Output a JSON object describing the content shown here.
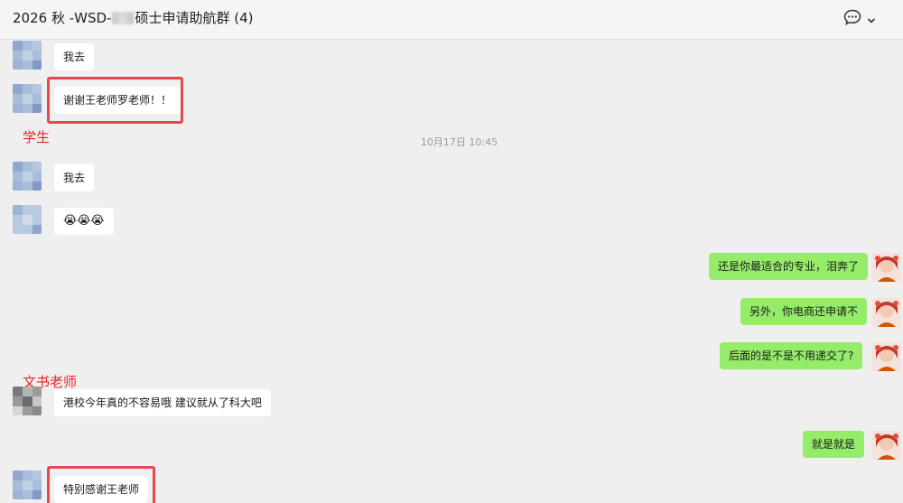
{
  "header": {
    "title_prefix": "2026 秋 -WSD-",
    "title_suffix": "硕士申请助航群 (4)"
  },
  "annotations": {
    "student": "学生",
    "writer": "文书老师"
  },
  "timestamp": "10月17日 10:45",
  "messages": [
    {
      "side": "in",
      "text": "我去"
    },
    {
      "side": "in",
      "text": "谢谢王老师罗老师！！"
    },
    {
      "side": "in",
      "text": "我去"
    },
    {
      "side": "in",
      "text": "😭😭😭"
    },
    {
      "side": "out",
      "text": "还是你最适合的专业，泪奔了"
    },
    {
      "side": "out",
      "text": "另外，你电商还申请不"
    },
    {
      "side": "out",
      "text": "后面的是不是不用递交了?"
    },
    {
      "side": "in",
      "text": "港校今年真的不容易哦  建议就从了科大吧"
    },
    {
      "side": "out",
      "text": "就是就是"
    },
    {
      "side": "in",
      "text": "特别感谢王老师"
    }
  ],
  "icons": {
    "chat_bubble": "chat-bubble-icon",
    "chevron": "chevron-down-icon"
  },
  "colors": {
    "outgoing_bubble": "#95ec69",
    "incoming_bubble": "#ffffff",
    "annotation_red": "#e3262d"
  }
}
